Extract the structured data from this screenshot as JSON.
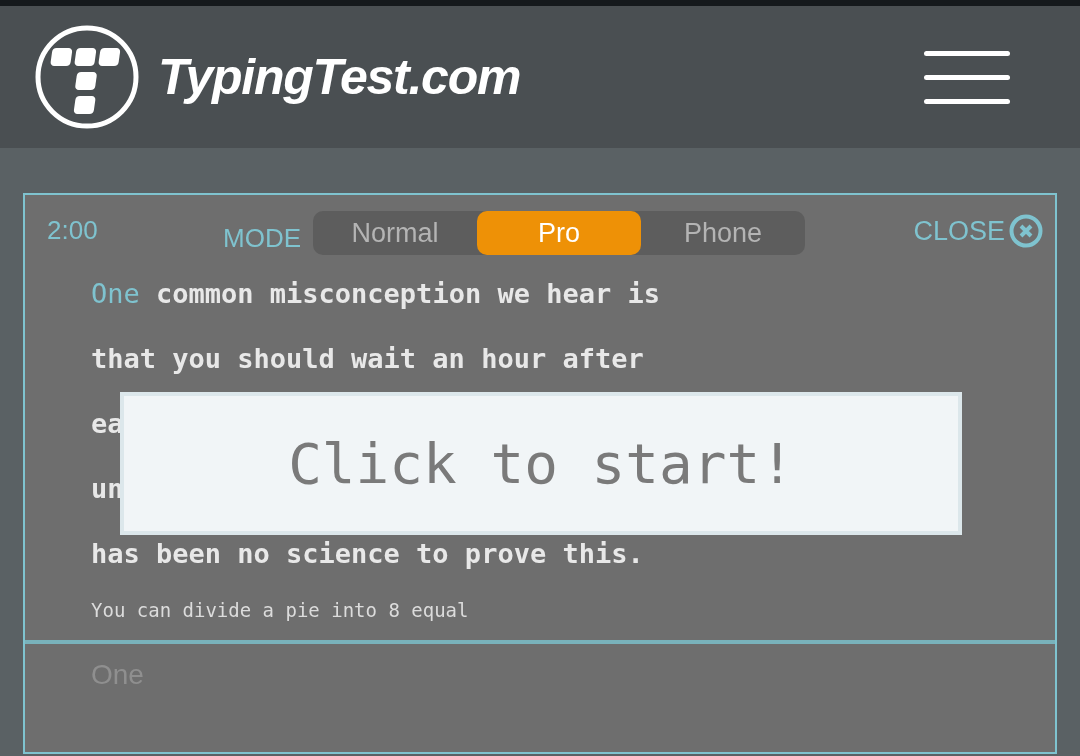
{
  "header": {
    "logo_text": "TypingTest.com"
  },
  "test": {
    "timer": "2:00",
    "mode_label": "MODE",
    "modes": [
      {
        "label": "Normal",
        "selected": false
      },
      {
        "label": "Pro",
        "selected": true
      },
      {
        "label": "Phone",
        "selected": false
      }
    ],
    "close_label": "CLOSE",
    "current_word": "One",
    "lines": [
      " common misconception we hear is",
      "that you should wait an hour after",
      "ea",
      "un",
      "has been no science to prove this."
    ],
    "next_line": "You can divide a pie into 8 equal",
    "input_value": "One",
    "start_prompt": "Click to start!"
  }
}
